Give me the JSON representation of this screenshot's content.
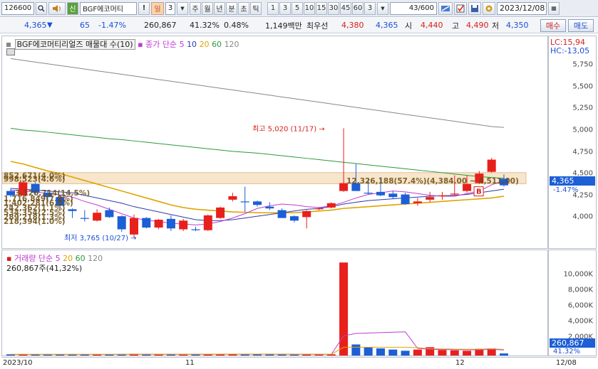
{
  "toolbar": {
    "code": "126600",
    "search_icon": "magnifier-icon",
    "stock_name": "BGF에코머티",
    "tag_sin": "신",
    "excl": "!",
    "period_active": "일",
    "period_count": "3",
    "periods": [
      "주",
      "월",
      "년",
      "분",
      "초",
      "틱"
    ],
    "minutes": [
      "1",
      "3",
      "5",
      "10",
      "15",
      "30",
      "45",
      "60",
      "3"
    ],
    "range": "43/600",
    "date": "2023/12/08"
  },
  "quote": {
    "price": "4,365",
    "change": "65",
    "change_pct": "-1.47%",
    "volume": "260,867",
    "vol_ratio": "41.32%",
    "rate": "0.48%",
    "amount": "1,149백만",
    "best_bid_label": "최우선",
    "best_ask": "4,380",
    "best_bid": "4,365",
    "open_label": "시",
    "open": "4,440",
    "high_label": "고",
    "high": "4,490",
    "low_label": "저",
    "low": "4,350",
    "buy_button": "매수",
    "sell_button": "매도"
  },
  "price_pane": {
    "legend_name": "BGF에코머티리얼즈 매물대 수(10)",
    "legend_ma": "종가 단순",
    "ma_periods": [
      "5",
      "10",
      "20",
      "60",
      "120"
    ],
    "lc": "LC:15,94",
    "hc": "HC:-13,05",
    "high_annot": "최고 5,020 (11/17)",
    "low_annot": "최저 3,765 (10/27)",
    "profile_labels": [
      "852,671(4.0%)",
      "998,523(4.6%)",
      "3,126,714(14.5%)",
      "1,716,849(7.8%)",
      "1,402,281(6.5%)",
      "242,362(1.1%)",
      "534,354(2.5%)",
      "289,218(1.3%)",
      "218,394(1.0%)"
    ],
    "profile_main": "12,326,188(57.4%)(4,384.00 ~ 4,511.00)",
    "current_price": "4,365",
    "current_pct": "-1.47%",
    "b_marker": "B"
  },
  "volume_pane": {
    "legend_name": "거래량",
    "legend_ma": "단순",
    "ma_periods": [
      "5",
      "20",
      "60",
      "120"
    ],
    "current_text": "260,867주(41,32%)",
    "current_value": "260,867",
    "current_pct": "41.32%"
  },
  "x_labels": [
    "2023/10",
    "11",
    "12",
    "12/08"
  ],
  "colors": {
    "up": "#e8201c",
    "down": "#1c5fd6",
    "ma5": "#c03ad4",
    "ma10": "#2f3aa8",
    "ma20": "#e0a400",
    "ma60": "#2b9a3b",
    "ma120": "#888888"
  },
  "chart_data": {
    "type": "candlestick",
    "price_ticks": [
      5750,
      5500,
      5250,
      5000,
      4750,
      4500,
      4250,
      4000
    ],
    "volume_ticks": [
      "10,000K",
      "8,000K",
      "6,000K",
      "4,000K",
      "2,000K"
    ],
    "candles": [
      {
        "o": 4300,
        "h": 4330,
        "l": 4230,
        "c": 4250
      },
      {
        "o": 4250,
        "h": 4420,
        "l": 4240,
        "c": 4400
      },
      {
        "o": 4380,
        "h": 4400,
        "l": 4260,
        "c": 4280
      },
      {
        "o": 4280,
        "h": 4310,
        "l": 4200,
        "c": 4230
      },
      {
        "o": 4230,
        "h": 4260,
        "l": 4110,
        "c": 4130
      },
      {
        "o": 4090,
        "h": 4100,
        "l": 3990,
        "c": 4070
      },
      {
        "o": 3990,
        "h": 4080,
        "l": 3950,
        "c": 3980
      },
      {
        "o": 3960,
        "h": 4090,
        "l": 3950,
        "c": 4050
      },
      {
        "o": 4080,
        "h": 4110,
        "l": 3990,
        "c": 4000
      },
      {
        "o": 4010,
        "h": 4020,
        "l": 3830,
        "c": 3860
      },
      {
        "o": 3800,
        "h": 4030,
        "l": 3765,
        "c": 3990
      },
      {
        "o": 3990,
        "h": 4000,
        "l": 3870,
        "c": 3880
      },
      {
        "o": 3880,
        "h": 3980,
        "l": 3860,
        "c": 3970
      },
      {
        "o": 3980,
        "h": 4020,
        "l": 3840,
        "c": 3870
      },
      {
        "o": 3860,
        "h": 3980,
        "l": 3840,
        "c": 3960
      },
      {
        "o": 3860,
        "h": 3890,
        "l": 3840,
        "c": 3850
      },
      {
        "o": 3850,
        "h": 4030,
        "l": 3840,
        "c": 4020
      },
      {
        "o": 3990,
        "h": 4120,
        "l": 3980,
        "c": 4110
      },
      {
        "o": 4200,
        "h": 4280,
        "l": 4180,
        "c": 4240
      },
      {
        "o": 4180,
        "h": 4350,
        "l": 4060,
        "c": 4170
      },
      {
        "o": 4180,
        "h": 4190,
        "l": 4120,
        "c": 4140
      },
      {
        "o": 4120,
        "h": 4170,
        "l": 4080,
        "c": 4100
      },
      {
        "o": 4080,
        "h": 4100,
        "l": 3990,
        "c": 3990
      },
      {
        "o": 4010,
        "h": 4020,
        "l": 3940,
        "c": 3960
      },
      {
        "o": 4000,
        "h": 4080,
        "l": 3870,
        "c": 4070
      },
      {
        "o": 4090,
        "h": 4110,
        "l": 4080,
        "c": 4100
      },
      {
        "o": 4110,
        "h": 4170,
        "l": 4100,
        "c": 4160
      },
      {
        "o": 4300,
        "h": 5020,
        "l": 4290,
        "c": 4390
      },
      {
        "o": 4390,
        "h": 4610,
        "l": 4310,
        "c": 4300
      },
      {
        "o": 4280,
        "h": 4440,
        "l": 4260,
        "c": 4270
      },
      {
        "o": 4290,
        "h": 4460,
        "l": 4240,
        "c": 4250
      },
      {
        "o": 4270,
        "h": 4300,
        "l": 4210,
        "c": 4230
      },
      {
        "o": 4260,
        "h": 4280,
        "l": 4140,
        "c": 4150
      },
      {
        "o": 4160,
        "h": 4220,
        "l": 4130,
        "c": 4180
      },
      {
        "o": 4200,
        "h": 4290,
        "l": 4170,
        "c": 4230
      },
      {
        "o": 4240,
        "h": 4290,
        "l": 4200,
        "c": 4250
      },
      {
        "o": 4260,
        "h": 4480,
        "l": 4240,
        "c": 4270
      },
      {
        "o": 4300,
        "h": 4480,
        "l": 4280,
        "c": 4380
      },
      {
        "o": 4390,
        "h": 4530,
        "l": 4380,
        "c": 4500
      },
      {
        "o": 4520,
        "h": 4680,
        "l": 4510,
        "c": 4660
      },
      {
        "o": 4440,
        "h": 4490,
        "l": 4350,
        "c": 4365
      }
    ],
    "volumes": [
      150,
      110,
      140,
      120,
      160,
      130,
      110,
      140,
      130,
      170,
      220,
      140,
      120,
      130,
      110,
      180,
      160,
      150,
      190,
      130,
      150,
      140,
      150,
      160,
      140,
      130,
      150,
      11800,
      1400,
      1050,
      900,
      750,
      600,
      750,
      1050,
      700,
      650,
      600,
      850,
      900,
      260
    ],
    "ma5": [
      4310,
      4300,
      4290,
      4270,
      4255,
      4230,
      4180,
      4140,
      4090,
      4040,
      3990,
      3965,
      3950,
      3930,
      3920,
      3910,
      3920,
      3950,
      3990,
      4040,
      4100,
      4130,
      4150,
      4140,
      4120,
      4110,
      4130,
      4170,
      4220,
      4260,
      4280,
      4300,
      4290,
      4270,
      4250,
      4240,
      4240,
      4270,
      4300,
      4370,
      4420
    ],
    "ma10": [
      4330,
      4320,
      4310,
      4300,
      4290,
      4280,
      4250,
      4220,
      4190,
      4160,
      4120,
      4090,
      4060,
      4030,
      4000,
      3970,
      3960,
      3960,
      3970,
      3990,
      4010,
      4030,
      4050,
      4070,
      4090,
      4100,
      4120,
      4150,
      4170,
      4190,
      4200,
      4210,
      4220,
      4230,
      4240,
      4245,
      4250,
      4260,
      4280,
      4300,
      4320
    ],
    "ma20": [
      4640,
      4610,
      4570,
      4530,
      4500,
      4460,
      4420,
      4380,
      4340,
      4300,
      4260,
      4220,
      4180,
      4140,
      4110,
      4090,
      4080,
      4070,
      4060,
      4055,
      4050,
      4050,
      4050,
      4050,
      4060,
      4070,
      4080,
      4100,
      4110,
      4120,
      4130,
      4140,
      4150,
      4160,
      4170,
      4180,
      4190,
      4200,
      4210,
      4220,
      4240
    ],
    "ma60": [
      5020,
      5000,
      4990,
      4975,
      4960,
      4945,
      4930,
      4915,
      4900,
      4890,
      4875,
      4860,
      4845,
      4830,
      4815,
      4800,
      4785,
      4770,
      4755,
      4745,
      4735,
      4720,
      4705,
      4690,
      4675,
      4660,
      4645,
      4630,
      4615,
      4600,
      4585,
      4570,
      4555,
      4540,
      4525,
      4510,
      4495,
      4480,
      4465,
      4455,
      4445
    ],
    "ma120": [
      5820,
      5800,
      5780,
      5760,
      5740,
      5720,
      5700,
      5680,
      5660,
      5640,
      5620,
      5600,
      5580,
      5560,
      5540,
      5520,
      5500,
      5480,
      5460,
      5440,
      5420,
      5400,
      5380,
      5360,
      5340,
      5320,
      5300,
      5280,
      5260,
      5240,
      5220,
      5200,
      5180,
      5160,
      5140,
      5120,
      5100,
      5080,
      5060,
      5040,
      5030
    ],
    "vol_ma": [
      140,
      140,
      140,
      140,
      140,
      140,
      140,
      140,
      140,
      145,
      150,
      150,
      150,
      150,
      150,
      150,
      150,
      155,
      160,
      160,
      160,
      160,
      155,
      150,
      150,
      150,
      145,
      2500,
      2800,
      2850,
      2900,
      2950,
      3000,
      900,
      780,
      760,
      730,
      720,
      720,
      780,
      700
    ]
  }
}
